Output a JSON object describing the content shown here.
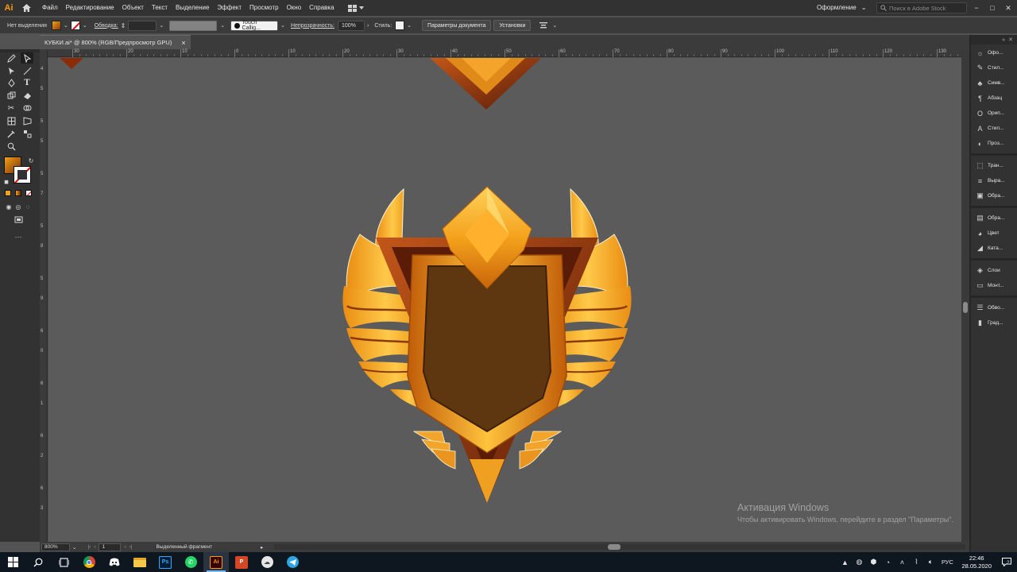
{
  "app": {
    "logo": "Ai",
    "workspace": "Оформление",
    "search_placeholder": "Поиск в Adobe Stock"
  },
  "menu": [
    "Файл",
    "Редактирование",
    "Объект",
    "Текст",
    "Выделение",
    "Эффект",
    "Просмотр",
    "Окно",
    "Справка"
  ],
  "control": {
    "selection": "Нет выделения",
    "stroke_label": "Обводка:",
    "brush": "Touch Callig...",
    "opacity_label": "Непрозрачность:",
    "opacity": "100%",
    "style_label": "Стиль:",
    "doc_settings": "Параметры документа",
    "preferences": "Установки"
  },
  "document": {
    "tab_title": "КУБКИ.ai* @ 800% (RGB/Предпросмотр GPU)",
    "close": "×"
  },
  "ruler_top": [
    "30",
    "20",
    "10",
    "0",
    "10",
    "20",
    "30",
    "40",
    "50",
    "60",
    "70",
    "80",
    "90",
    "100",
    "110",
    "120",
    "130"
  ],
  "ruler_left": [
    "4",
    "5",
    "5",
    "5",
    "5",
    "7",
    "5",
    "8",
    "5",
    "9",
    "6",
    "0",
    "6",
    "1",
    "6",
    "2",
    "6",
    "3"
  ],
  "status": {
    "zoom": "800%",
    "page": "1",
    "tool": "Выделенный фрагмент"
  },
  "panels": [
    {
      "label": "Офо...",
      "icon": "sun-icon"
    },
    {
      "label": "Стил...",
      "icon": "brush-icon"
    },
    {
      "label": "Симв...",
      "icon": "symbol-icon"
    },
    {
      "label": "Абзац",
      "icon": "paragraph-icon"
    },
    {
      "label": "Орип...",
      "icon": "opentype-icon"
    },
    {
      "label": "Стил...",
      "icon": "char-style-icon"
    },
    {
      "label": "Проз...",
      "icon": "transparency-icon"
    },
    {
      "label": "Тран...",
      "icon": "transform-icon"
    },
    {
      "label": "Выра...",
      "icon": "align-icon"
    },
    {
      "label": "Обра...",
      "icon": "pathfinder-icon"
    },
    {
      "label": "Обра...",
      "icon": "image-trace-icon"
    },
    {
      "label": "Цвет",
      "icon": "color-icon"
    },
    {
      "label": "Ката...",
      "icon": "catalog-icon"
    },
    {
      "label": "Слои",
      "icon": "layers-icon"
    },
    {
      "label": "Монт...",
      "icon": "artboards-icon"
    },
    {
      "label": "Обво...",
      "icon": "stroke-icon"
    },
    {
      "label": "Град...",
      "icon": "gradient-icon"
    }
  ],
  "watermark": {
    "title": "Активация Windows",
    "subtitle": "Чтобы активировать Windows, перейдите в раздел \"Параметры\"."
  },
  "taskbar": {
    "language": "РУС",
    "time": "22:46",
    "date": "28.05.2020",
    "notifications": "2"
  },
  "colors": {
    "fill_dark": "#5a3410",
    "gold": "#f5a623",
    "bronze": "#8a3a0a"
  }
}
